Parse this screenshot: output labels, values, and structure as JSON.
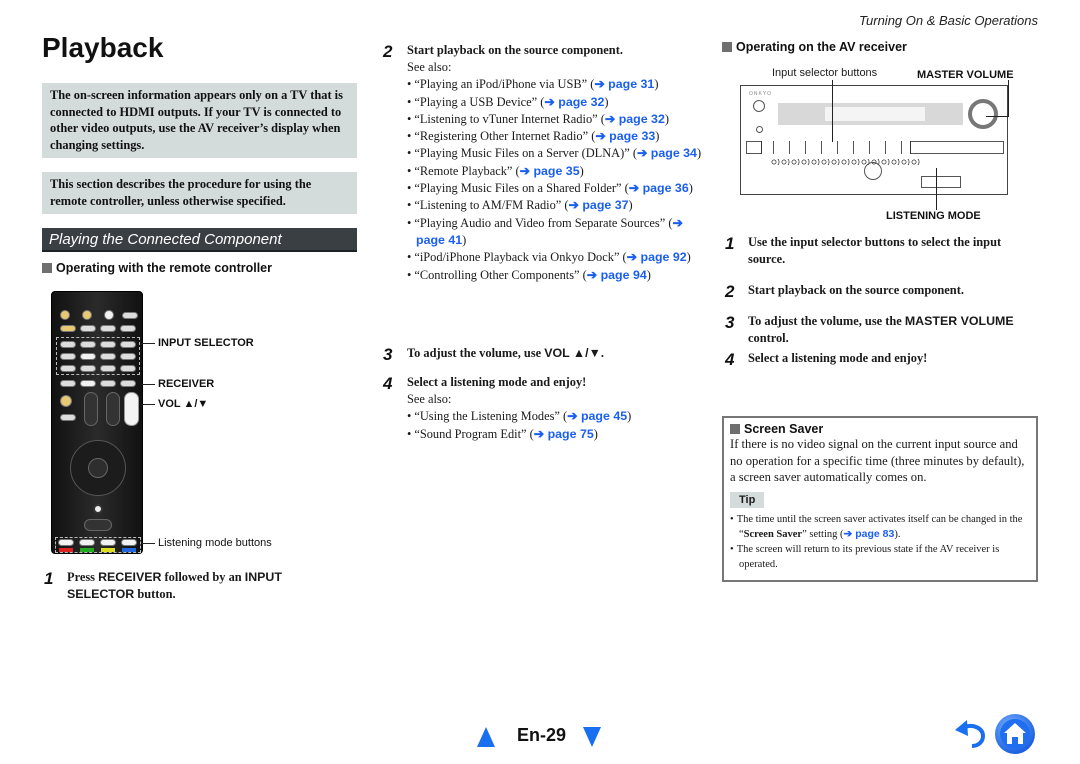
{
  "header": {
    "title": "Playback",
    "section": "Turning On & Basic Operations"
  },
  "left": {
    "notice1": "The on-screen information appears only on a TV that is connected to HDMI outputs. If your TV is connected to other video outputs, use the AV receiver’s display when changing settings.",
    "notice2": "This section describes the procedure for using the remote controller, unless otherwise specified.",
    "banner": "Playing the Connected Component",
    "subhead": "Operating with the remote controller",
    "callouts": {
      "input_selector": "INPUT SELECTOR",
      "receiver": "RECEIVER",
      "vol": "VOL ▲/▼",
      "listening": "Listening mode buttons"
    },
    "step1": {
      "num": "1",
      "pre": "Press ",
      "b1": "RECEIVER",
      "mid": " followed by an ",
      "b2": "INPUT SELECTOR",
      "post": " button."
    }
  },
  "middle": {
    "step2": {
      "num": "2",
      "text": "Start playback on the source component.",
      "see_also": "See also:",
      "items": [
        {
          "text": "“Playing an iPod/iPhone via USB” (",
          "link": "➔ page 31",
          "post": ")"
        },
        {
          "text": "“Playing a USB Device” (",
          "link": "➔ page 32",
          "post": ")"
        },
        {
          "text": "“Listening to vTuner Internet Radio” (",
          "link": "➔ page 32",
          "post": ")"
        },
        {
          "text": "“Registering Other Internet Radio” (",
          "link": "➔ page 33",
          "post": ")"
        },
        {
          "text": "“Playing Music Files on a Server (DLNA)” (",
          "link": "➔ page 34",
          "post": ")"
        },
        {
          "text": "“Remote Playback” (",
          "link": "➔ page 35",
          "post": ")"
        },
        {
          "text": "“Playing Music Files on a Shared Folder” (",
          "link": "➔ page 36",
          "post": ")"
        },
        {
          "text": "“Listening to AM/FM Radio” (",
          "link": "➔ page 37",
          "post": ")"
        },
        {
          "text": "“Playing Audio and Video from Separate Sources” (",
          "link": "➔ page 41",
          "post": ")"
        },
        {
          "text": "“iPod/iPhone Playback via Onkyo Dock” (",
          "link": "➔ page 92",
          "post": ")"
        },
        {
          "text": "“Controlling Other Components” (",
          "link": "➔ page 94",
          "post": ")"
        }
      ]
    },
    "step3": {
      "num": "3",
      "pre": "To adjust the volume, use ",
      "b": "VOL ▲/▼",
      "post": "."
    },
    "step4": {
      "num": "4",
      "text": "Select a listening mode and enjoy!",
      "see_also": "See also:",
      "items": [
        {
          "text": "“Using the Listening Modes” (",
          "link": "➔ page 45",
          "post": ")"
        },
        {
          "text": "“Sound Program Edit” (",
          "link": "➔ page 75",
          "post": ")"
        }
      ]
    }
  },
  "right": {
    "subhead": "Operating on the AV receiver",
    "callouts": {
      "input_selector_buttons": "Input selector buttons",
      "master_volume": "MASTER VOLUME",
      "listening_mode": "LISTENING MODE"
    },
    "brand": "ONKYO",
    "steps": [
      {
        "num": "1",
        "text": "Use the input selector buttons to select the input source."
      },
      {
        "num": "2",
        "text": "Start playback on the source component."
      },
      {
        "num": "3",
        "pre": "To adjust the volume, use the ",
        "b": "MASTER VOLUME",
        "post": " control."
      },
      {
        "num": "4",
        "text": "Select a listening mode and enjoy!"
      }
    ],
    "screen_saver": {
      "title": "Screen Saver",
      "body": "If there is no video signal on the current input source and no operation for a specific time (three minutes by default), a screen saver automatically comes on.",
      "tip_label": "Tip",
      "tip1_pre": "The time until the screen saver activates itself can be changed in the “",
      "tip1_b": "Screen Saver",
      "tip1_mid": "” setting (",
      "tip1_link": "➔ page 83",
      "tip1_post": ").",
      "tip2": "The screen will return to its previous state if the AV receiver is operated."
    }
  },
  "footer": {
    "page_label": "En-29",
    "prev_icon": "triangle-up",
    "next_icon": "triangle-down",
    "back_icon": "back-arrow",
    "home_icon": "home"
  },
  "colors": {
    "link": "#1a5ff0",
    "notice_bg": "#d4dcdb",
    "banner_bg": "#3a3f44",
    "nav_blue": "#1a6ff0"
  }
}
